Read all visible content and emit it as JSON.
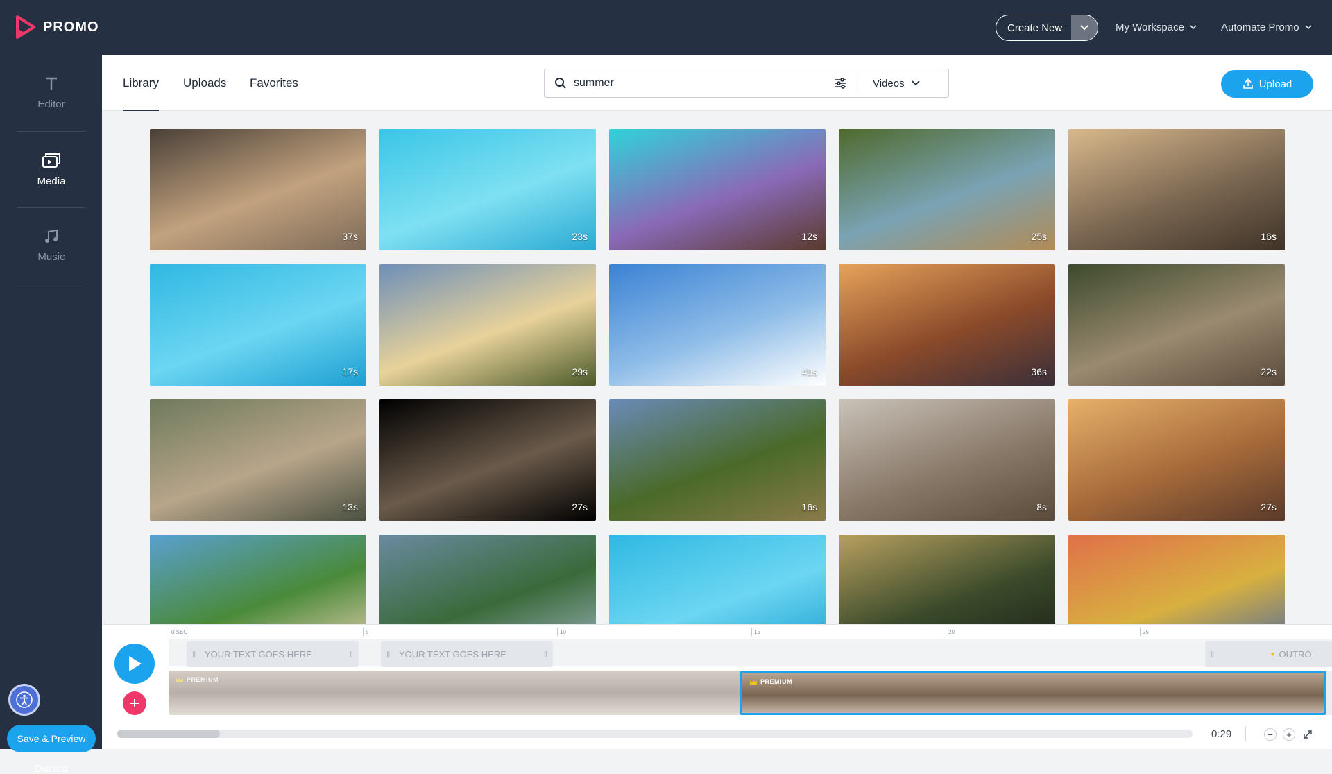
{
  "header": {
    "logo_text": "PROMO",
    "create_new_label": "Create New",
    "workspace_label": "My Workspace",
    "automate_label": "Automate Promo"
  },
  "sidebar": {
    "items": [
      {
        "label": "Editor",
        "icon": "text-icon",
        "active": false
      },
      {
        "label": "Media",
        "icon": "media-icon",
        "active": true
      },
      {
        "label": "Music",
        "icon": "music-note-icon",
        "active": false
      }
    ],
    "save_label": "Save & Preview",
    "discard_label": "Discard"
  },
  "library": {
    "tabs": [
      {
        "label": "Library",
        "active": true
      },
      {
        "label": "Uploads",
        "active": false
      },
      {
        "label": "Favorites",
        "active": false
      }
    ],
    "search_value": "summer",
    "filter_selected": "Videos",
    "upload_label": "Upload"
  },
  "thumbnails": [
    {
      "duration": "37s",
      "palette": [
        "#4a4038",
        "#c2a27e",
        "#7d6a58"
      ]
    },
    {
      "duration": "23s",
      "palette": [
        "#39c6e6",
        "#7fe0f2",
        "#2aa9d3"
      ]
    },
    {
      "duration": "12s",
      "palette": [
        "#2fd3d9",
        "#8a6ab8",
        "#5a3a2c"
      ]
    },
    {
      "duration": "25s",
      "palette": [
        "#4f6a2d",
        "#7aa3b4",
        "#b28b55"
      ]
    },
    {
      "duration": "16s",
      "palette": [
        "#d9b98c",
        "#7b6752",
        "#3f3327"
      ]
    },
    {
      "duration": "17s",
      "palette": [
        "#2fb8e2",
        "#6cd6f2",
        "#1d9fd2"
      ]
    },
    {
      "duration": "29s",
      "palette": [
        "#6d8fb8",
        "#e8d29a",
        "#4b5a2a"
      ]
    },
    {
      "duration": "49s",
      "palette": [
        "#3b82d4",
        "#8fbde8",
        "#ffffff"
      ]
    },
    {
      "duration": "36s",
      "palette": [
        "#e6a25a",
        "#8b4a2a",
        "#3a2f3a"
      ]
    },
    {
      "duration": "22s",
      "palette": [
        "#3d4a2c",
        "#9a8a70",
        "#5a4a3a"
      ]
    },
    {
      "duration": "13s",
      "palette": [
        "#6f7a5c",
        "#b8a58a",
        "#4a5040"
      ]
    },
    {
      "duration": "27s",
      "palette": [
        "#000000",
        "#6a5a4a",
        "#000000"
      ]
    },
    {
      "duration": "16s",
      "palette": [
        "#6a8ab8",
        "#4a6a2a",
        "#8a7a4a"
      ]
    },
    {
      "duration": "8s",
      "palette": [
        "#c9c2b8",
        "#8a7a6a",
        "#5a4a3a"
      ]
    },
    {
      "duration": "27s",
      "palette": [
        "#e6b06a",
        "#a66a3a",
        "#5a3a2a"
      ]
    },
    {
      "duration": "",
      "palette": [
        "#5aa0d0",
        "#4a8a3a",
        "#e8d0b0"
      ]
    },
    {
      "duration": "",
      "palette": [
        "#6a8aa0",
        "#3a6a3a",
        "#9ab0b8"
      ]
    },
    {
      "duration": "",
      "palette": [
        "#2fb8e2",
        "#6cd6f2",
        "#1d9fd2"
      ]
    },
    {
      "duration": "",
      "palette": [
        "#b8a060",
        "#3a4a2a",
        "#1a2018"
      ]
    },
    {
      "duration": "",
      "palette": [
        "#e0704a",
        "#d8b040",
        "#4a6aa0"
      ]
    }
  ],
  "timeline": {
    "ruler_labels": [
      "0 SEC",
      "5",
      "10",
      "15",
      "20",
      "25"
    ],
    "text_clips": [
      "YOUR TEXT GOES HERE",
      "YOUR TEXT GOES HERE"
    ],
    "outro_label": "OUTRO",
    "premium_label": "PREMIUM",
    "time_readout": "0:29"
  },
  "colors": {
    "dark": "#253142",
    "accent": "#1ba3ee",
    "add": "#f0376a"
  }
}
